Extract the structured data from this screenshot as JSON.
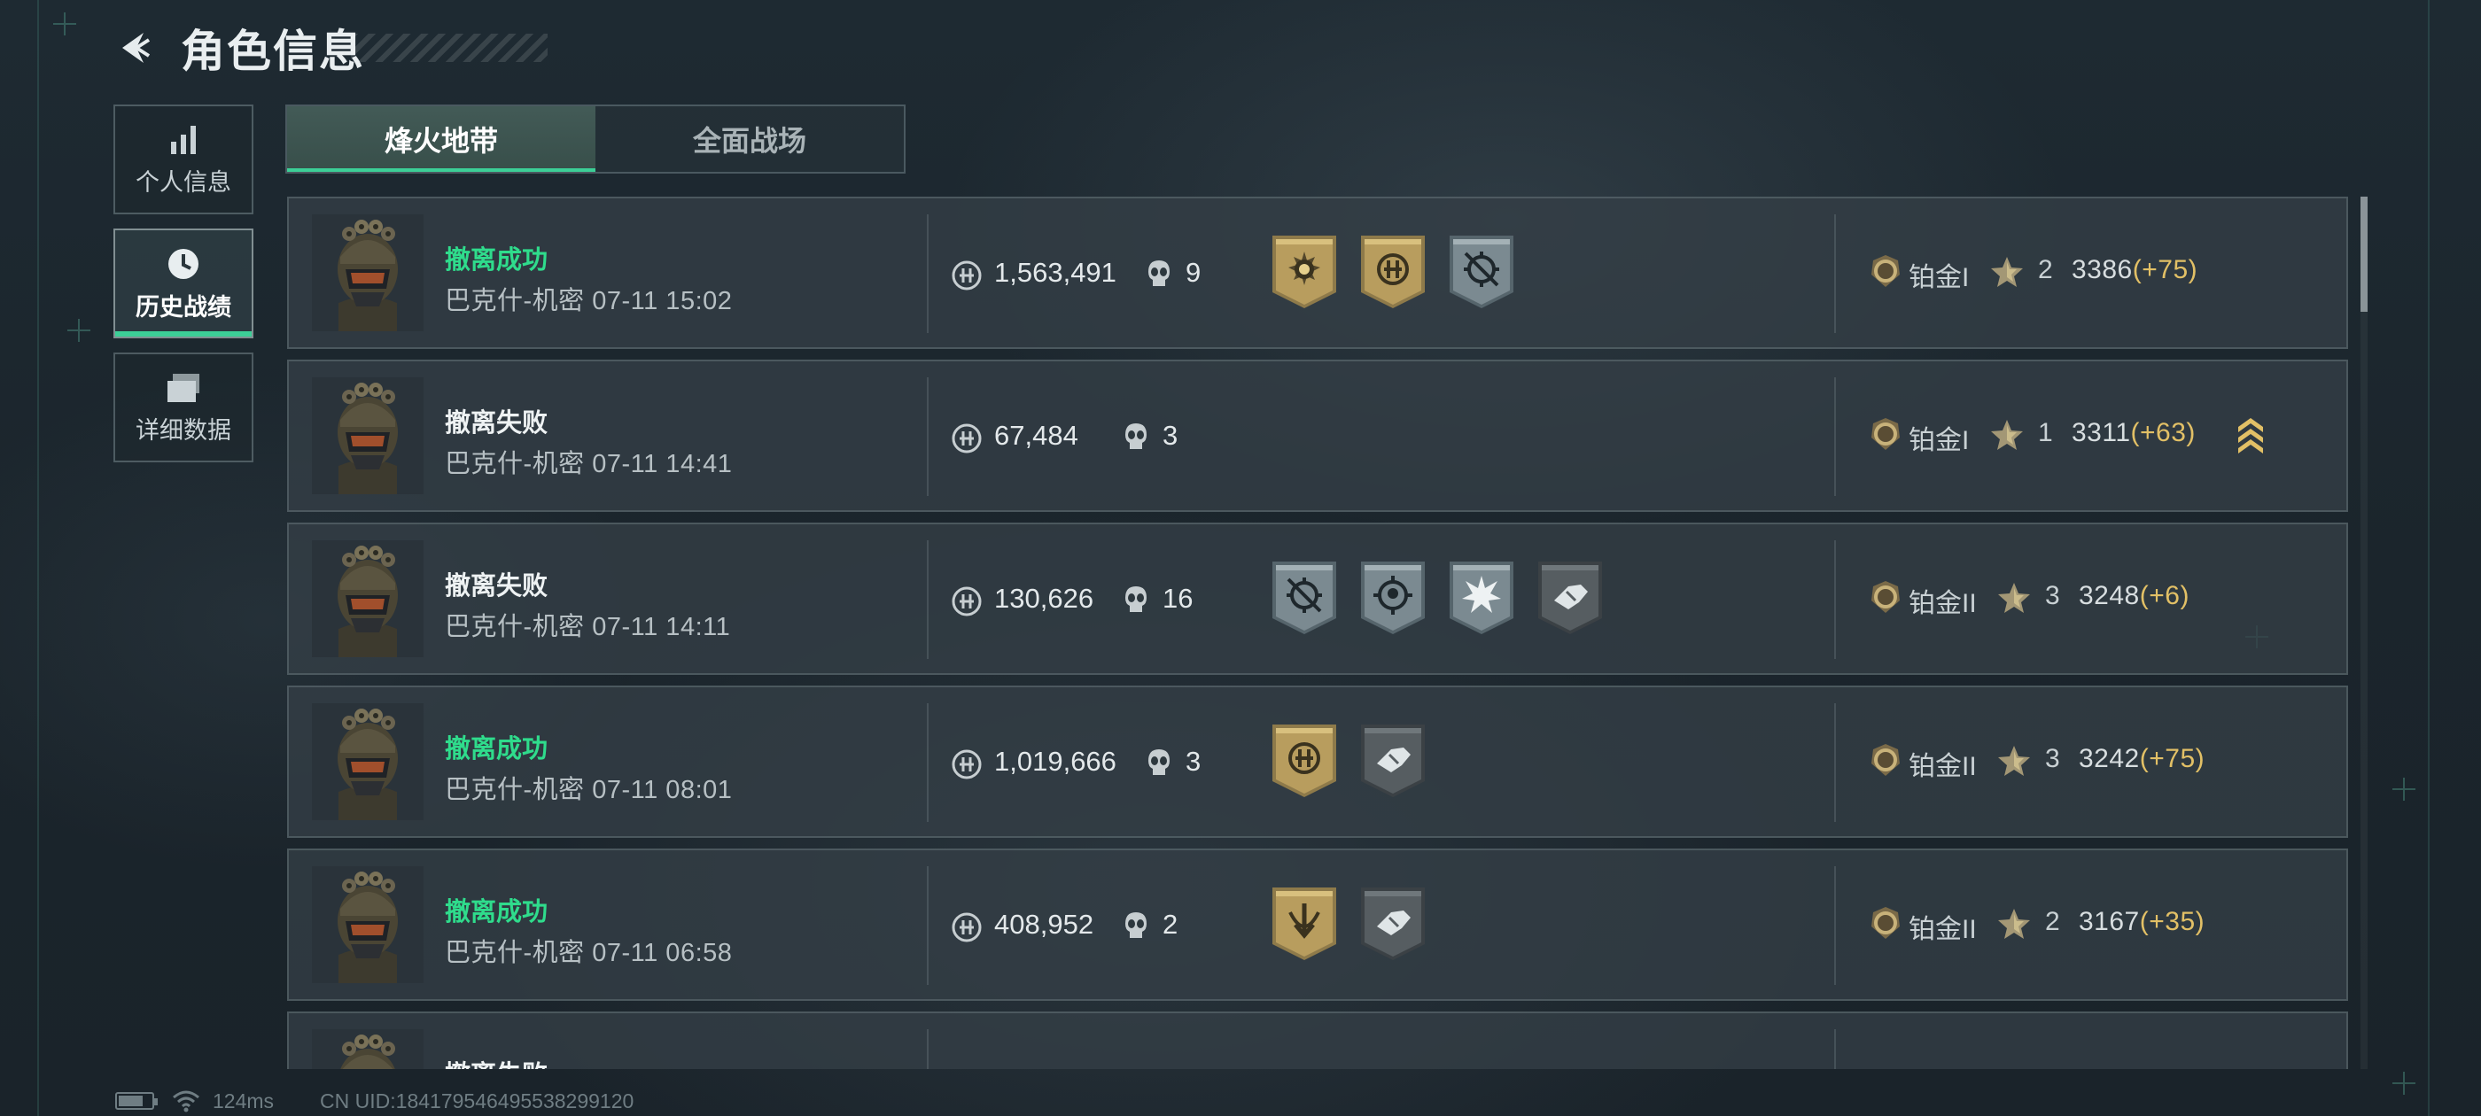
{
  "header": {
    "title": "角色信息"
  },
  "nav": [
    {
      "label": "个人信息",
      "icon": "bar-chart-icon",
      "active": false
    },
    {
      "label": "历史战绩",
      "icon": "clock-icon",
      "active": true
    },
    {
      "label": "详细数据",
      "icon": "folders-icon",
      "active": false
    }
  ],
  "tabs": [
    {
      "label": "烽火地带",
      "active": true
    },
    {
      "label": "全面战场",
      "active": false
    }
  ],
  "matches": [
    {
      "status": "撤离成功",
      "result": "success",
      "map": "巴克什-机密",
      "time": "07-11 15:02",
      "value": "1,563,491",
      "kills": "9",
      "badges": [
        "sun-badge-gold",
        "coin-badge-gold",
        "crosshair-badge-silver"
      ],
      "rank": "铂金I",
      "rank_tier": "I",
      "stars": "2",
      "score": "3386",
      "delta": "(+75)",
      "promoted": false
    },
    {
      "status": "撤离失败",
      "result": "fail",
      "map": "巴克什-机密",
      "time": "07-11 14:41",
      "value": "67,484",
      "kills": "3",
      "badges": [],
      "rank": "铂金I",
      "rank_tier": "I",
      "stars": "1",
      "score": "3311",
      "delta": "(+63)",
      "promoted": true
    },
    {
      "status": "撤离失败",
      "result": "fail",
      "map": "巴克什-机密",
      "time": "07-11 14:11",
      "value": "130,626",
      "kills": "16",
      "badges": [
        "crosshair-badge-silver",
        "target-badge-silver",
        "burst-badge-silver",
        "hand-badge-dark"
      ],
      "rank": "铂金II",
      "rank_tier": "II",
      "stars": "3",
      "score": "3248",
      "delta": "(+6)",
      "promoted": false
    },
    {
      "status": "撤离成功",
      "result": "success",
      "map": "巴克什-机密",
      "time": "07-11 08:01",
      "value": "1,019,666",
      "kills": "3",
      "badges": [
        "coin-badge-gold",
        "hand-badge-dark"
      ],
      "rank": "铂金II",
      "rank_tier": "II",
      "stars": "3",
      "score": "3242",
      "delta": "(+75)",
      "promoted": false
    },
    {
      "status": "撤离成功",
      "result": "success",
      "map": "巴克什-机密",
      "time": "07-11 06:58",
      "value": "408,952",
      "kills": "2",
      "badges": [
        "arrow-badge-gold",
        "hand-badge-dark"
      ],
      "rank": "铂金II",
      "rank_tier": "II",
      "stars": "2",
      "score": "3167",
      "delta": "(+35)",
      "promoted": false
    },
    {
      "status": "撤离失败",
      "result": "fail",
      "map": "",
      "time": "",
      "value": "",
      "kills": "",
      "badges": [],
      "rank": "",
      "rank_tier": "",
      "stars": "",
      "score": "",
      "delta": "",
      "promoted": false
    }
  ],
  "footer": {
    "ping": "124ms",
    "uid": "CN UID:18417954649553829912​0",
    "battery_level": 0.75
  },
  "colors": {
    "success": "#2fdc8c",
    "accent": "#3ccf97",
    "gold": "#e2c066"
  }
}
